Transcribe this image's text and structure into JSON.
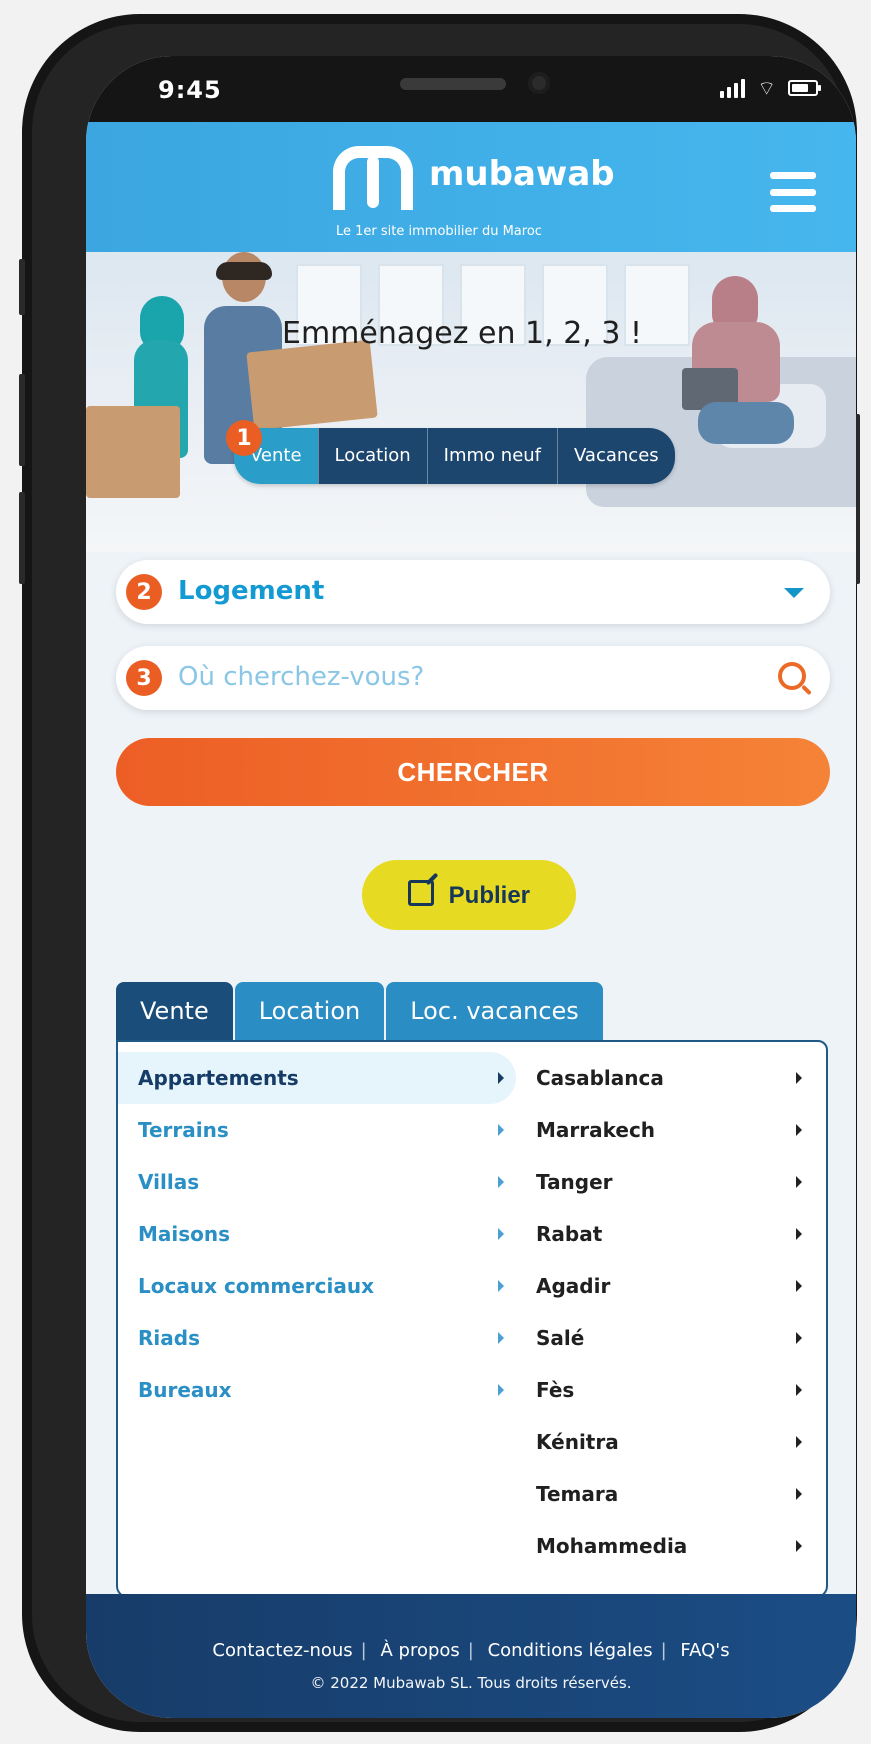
{
  "statusbar": {
    "time": "9:45"
  },
  "header": {
    "brand": "mubawab",
    "tagline": "Le 1er site immobilier du Maroc",
    "menu_icon": "hamburger-icon"
  },
  "hero": {
    "title": "Emménagez en 1, 2, 3 !",
    "tabs": [
      "Vente",
      "Location",
      "Immo neuf",
      "Vacances"
    ],
    "active_tab": "Vente",
    "step1": "1"
  },
  "search": {
    "step2": "2",
    "category": "Logement",
    "step3": "3",
    "placeholder": "Où cherchez-vous?"
  },
  "actions": {
    "search_button": "CHERCHER",
    "publish_button": "Publier"
  },
  "listings": {
    "tabs": [
      "Vente",
      "Location",
      "Loc. vacances"
    ],
    "active_tab": "Vente",
    "property_types": [
      "Appartements",
      "Terrains",
      "Villas",
      "Maisons",
      "Locaux commerciaux",
      "Riads",
      "Bureaux"
    ],
    "cities": [
      "Casablanca",
      "Marrakech",
      "Tanger",
      "Rabat",
      "Agadir",
      "Salé",
      "Fès",
      "Kénitra",
      "Temara",
      "Mohammedia"
    ]
  },
  "footer": {
    "links": [
      "Contactez-nous",
      "À propos",
      "Conditions légales",
      "FAQ's"
    ],
    "copyright": "© 2022 Mubawab SL. Tous droits réservés."
  },
  "colors": {
    "header_blue": "#3ba6e0",
    "navy": "#1a4d79",
    "orange": "#ed5e25",
    "yellow": "#e7da22"
  }
}
